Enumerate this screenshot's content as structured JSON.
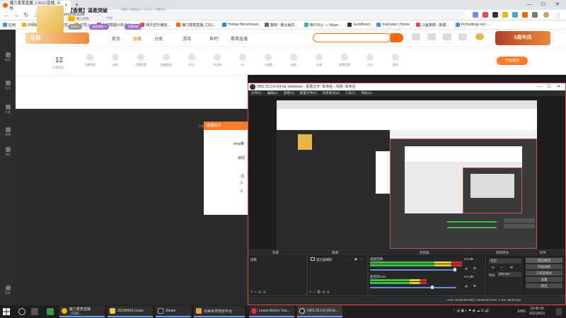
{
  "browser": {
    "tab_title": "魔力香蕉直播_CSGO直播_斗鱼",
    "url": "douyu.com/2081168",
    "bookmarks": [
      "应用",
      "外网链接",
      "导入书签",
      "已导入",
      "抖音截图分析办公...",
      "网页音乐播放...",
      "魔力香蕉直播_CSG...",
      "Human Benchmark",
      "翻墙 - 聚合最优...",
      "用户中心 — Wave...",
      "SockBoom",
      "InsFooter | Home",
      "斗鱼数据 - 数据...",
      "ProSettings.net -..."
    ]
  },
  "sidebar": {
    "items": [
      "推荐",
      "关注",
      "分类",
      "直播",
      "游戏",
      "更多"
    ]
  },
  "header": {
    "logo": "斗鱼",
    "nav": [
      "首页",
      "直播",
      "分类",
      "游戏",
      "鱼吧",
      "赛事直播"
    ],
    "banner": "5周年庆"
  },
  "tools": {
    "fans_count": "12",
    "fans_label": "主播等级",
    "items": [
      "主播等级",
      "连线",
      "开播设置",
      "直播画面",
      "积分",
      "节目单",
      "PK",
      "小组赛",
      "抽奖",
      "礼物",
      "直播设置",
      "活动",
      "更多"
    ],
    "open_live": "开始直播"
  },
  "room": {
    "title": "【香蕉】温柔突破",
    "meta": "直播 · 网游竞技 · CSGO · 开播时长",
    "anchor": "魔力香蕉",
    "share": "举报",
    "badges": [
      "CSGO",
      "温柔突破 ✦",
      "主播热度"
    ]
  },
  "popup": {
    "title": "直播提示",
    "lines": [
      "rtmp推",
      "目前",
      "注:",
      "1.",
      "2."
    ]
  },
  "stage_hint": "主播正在直播中，请...",
  "obs": {
    "title": "OBS 25.0.8 (64-bit, windows) - 配置文件: 未命名 - 场景: 未命名",
    "menu": [
      "文件(F)",
      "编辑(E)",
      "查看(V)",
      "配置文件(P)",
      "场景集合(S)",
      "工具(T)",
      "帮助(H)"
    ],
    "docks": [
      "场景",
      "来源",
      "混音器",
      "转场特效",
      "控件"
    ],
    "scene": "场景",
    "source": "显示器捕获",
    "mixer": [
      {
        "label": "桌面音频",
        "level": "0.0 dB"
      },
      {
        "label": "麦克风/Aux",
        "level": "0.0 dB"
      }
    ],
    "transition": {
      "type": "淡出",
      "duration_label": "时长",
      "duration": "300 ms"
    },
    "controls": [
      "停止推流",
      "开始录制",
      "工作室模式",
      "设置",
      "退出"
    ],
    "status": "LIVE: 00:00:00   REC: 00:00:00   CPU: 1.3%, 60.00 fps"
  },
  "taskbar": {
    "apps": [
      "魔力香蕉直播_CSG...",
      "26338463-Oasis",
      "Steam",
      "完美世界竞技平台",
      "Leave Before You...",
      "OBS 25.0.8 (64-bi..."
    ],
    "lang": "ENG",
    "time": "19:45:35",
    "date": "2021/6/21"
  },
  "colors": {
    "accent": "#ff7b2c",
    "obs_border": "#e84a4a",
    "mixer_green": "#3fbf3f"
  }
}
